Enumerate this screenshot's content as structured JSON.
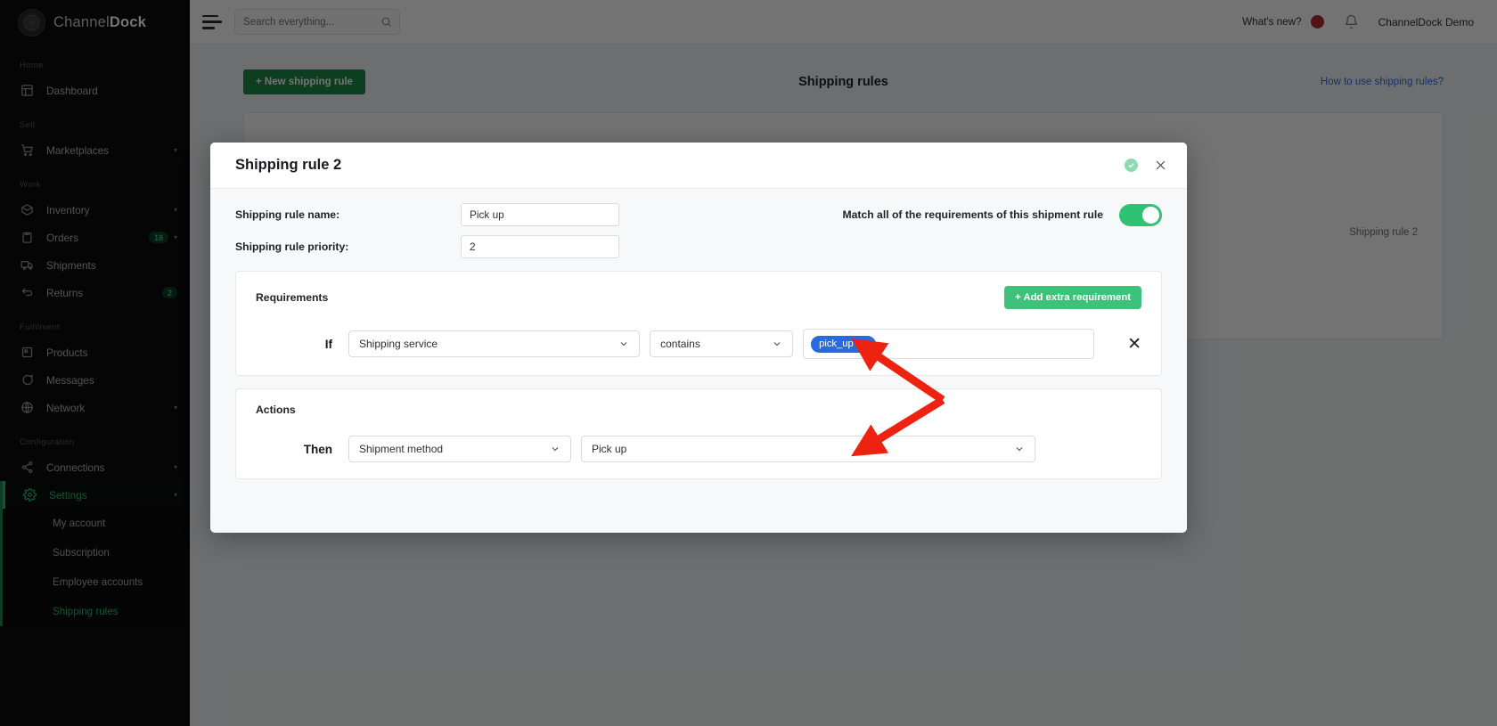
{
  "sidebar": {
    "brand": {
      "part1": "Channel",
      "part2": "Dock"
    },
    "sections": [
      {
        "label": "Home",
        "items": [
          {
            "label": "Dashboard",
            "icon": "dashboard-icon",
            "caret": false,
            "badge": ""
          }
        ]
      },
      {
        "label": "Sell",
        "items": [
          {
            "label": "Marketplaces",
            "icon": "cart-icon",
            "caret": true,
            "badge": ""
          }
        ]
      },
      {
        "label": "Work",
        "items": [
          {
            "label": "Inventory",
            "icon": "box-icon",
            "caret": true,
            "badge": ""
          },
          {
            "label": "Orders",
            "icon": "clipboard-icon",
            "caret": true,
            "badge": "18"
          },
          {
            "label": "Shipments",
            "icon": "truck-icon",
            "caret": false,
            "badge": ""
          },
          {
            "label": "Returns",
            "icon": "return-icon",
            "caret": false,
            "badge": "2"
          }
        ]
      },
      {
        "label": "Fulfilment",
        "items": [
          {
            "label": "Products",
            "icon": "products-icon",
            "caret": false,
            "badge": ""
          },
          {
            "label": "Messages",
            "icon": "chat-icon",
            "caret": false,
            "badge": ""
          },
          {
            "label": "Network",
            "icon": "network-icon",
            "caret": true,
            "badge": ""
          }
        ]
      },
      {
        "label": "Configuration",
        "items": [
          {
            "label": "Connections",
            "icon": "share-icon",
            "caret": true,
            "badge": ""
          }
        ]
      }
    ],
    "settings": {
      "label": "Settings",
      "icon": "gear-icon",
      "caret": true
    },
    "settings_children": [
      {
        "label": "My account",
        "active": false
      },
      {
        "label": "Subscription",
        "active": false
      },
      {
        "label": "Employee accounts",
        "active": false
      },
      {
        "label": "Shipping rules",
        "active": true
      }
    ]
  },
  "topbar": {
    "search_placeholder": "Search everything...",
    "whats_new": "What's new?",
    "user": "ChannelDock Demo"
  },
  "page": {
    "new_rule_button": "+ New shipping rule",
    "title": "Shipping rules",
    "help_link": "How to use shipping rules?",
    "card_note": "Shipping rule 2"
  },
  "modal": {
    "title": "Shipping rule 2",
    "name_label": "Shipping rule name:",
    "name_value": "Pick up",
    "priority_label": "Shipping rule priority:",
    "priority_value": "2",
    "match_label": "Match all of the requirements of this shipment rule",
    "match_enabled": true,
    "requirements": {
      "heading": "Requirements",
      "add_button": "+ Add extra requirement",
      "rows": [
        {
          "keyword": "If",
          "field": "Shipping service",
          "operator": "contains",
          "tags": [
            "pick_up"
          ]
        }
      ]
    },
    "actions": {
      "heading": "Actions",
      "rows": [
        {
          "keyword": "Then",
          "action": "Shipment method",
          "value": "Pick up"
        }
      ]
    }
  },
  "colors": {
    "brand_green": "#2ebd76",
    "button_green": "#3ec27a",
    "new_rule_green": "#1f8a4c",
    "tag_blue": "#2a6ae0",
    "link_blue": "#2f6fe0",
    "annotation_red": "#ee2211",
    "sidebar_bg": "#0c0c0c"
  }
}
